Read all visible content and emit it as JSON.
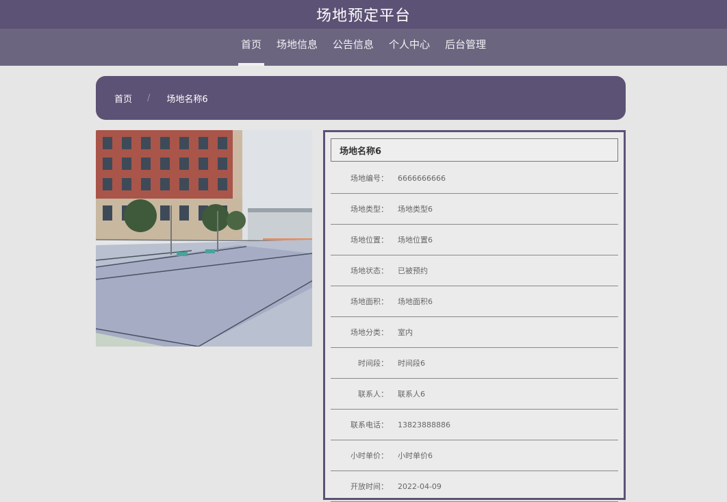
{
  "site": {
    "title": "场地预定平台"
  },
  "nav": {
    "items": [
      {
        "label": "首页"
      },
      {
        "label": "场地信息"
      },
      {
        "label": "公告信息"
      },
      {
        "label": "个人中心"
      },
      {
        "label": "后台管理"
      }
    ]
  },
  "breadcrumb": {
    "home": "首页",
    "separator": "/",
    "current": "场地名称6"
  },
  "details": {
    "title": "场地名称6",
    "rows": [
      {
        "label": "场地编号：",
        "value": "6666666666"
      },
      {
        "label": "场地类型：",
        "value": "场地类型6"
      },
      {
        "label": "场地位置：",
        "value": "场地位置6"
      },
      {
        "label": "场地状态：",
        "value": "已被预约"
      },
      {
        "label": "场地面积：",
        "value": "场地面积6"
      },
      {
        "label": "场地分类：",
        "value": "室内"
      },
      {
        "label": "时间段：",
        "value": "时间段6"
      },
      {
        "label": "联系人：",
        "value": "联系人6"
      },
      {
        "label": "联系电话：",
        "value": "13823888886"
      },
      {
        "label": "小时单价：",
        "value": "小时单价6"
      },
      {
        "label": "开放时间：",
        "value": "2022-04-09"
      }
    ]
  },
  "colors": {
    "primary": "#5c5275",
    "nav": "#6b6580",
    "background": "#e6e6e6"
  }
}
